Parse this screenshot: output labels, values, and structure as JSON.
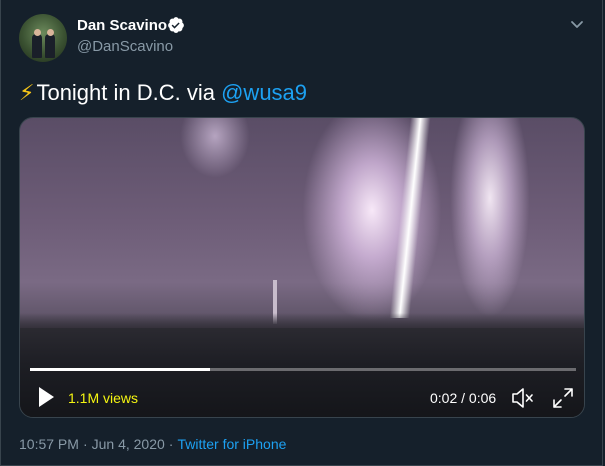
{
  "user": {
    "display_name": "Dan Scavino",
    "username": "@DanScavino",
    "verified": true,
    "avatar_icon": "avatar"
  },
  "tweet": {
    "emoji": "⚡",
    "text": "Tonight in D.C. via ",
    "mention": "@wusa9"
  },
  "video": {
    "views": "1.1M views",
    "time": "0:02 / 0:06",
    "progress": 0.33
  },
  "footer": {
    "time": "10:57 PM",
    "separator": "·",
    "date": "Jun 4, 2020",
    "source": "Twitter for iPhone"
  },
  "colors": {
    "background": "#15202b",
    "link": "#1da1f2",
    "muted": "#8899a6",
    "views": "#f5f511"
  }
}
